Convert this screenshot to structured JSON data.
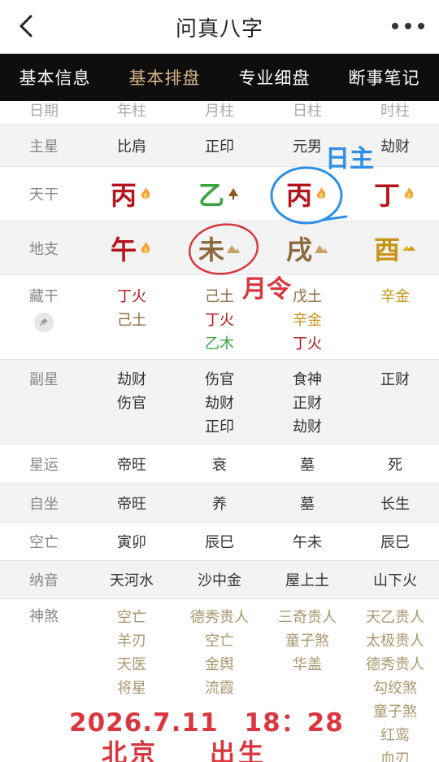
{
  "header": {
    "title": "问真八字"
  },
  "tabs": [
    {
      "label": "基本信息",
      "active": false
    },
    {
      "label": "基本排盘",
      "active": true
    },
    {
      "label": "专业细盘",
      "active": false
    },
    {
      "label": "断事笔记",
      "active": false
    }
  ],
  "columns": [
    "日期",
    "年柱",
    "月柱",
    "日柱",
    "时柱"
  ],
  "rows": {
    "zhuxing": {
      "label": "主星",
      "values": [
        "比肩",
        "正印",
        "元男",
        "劫财"
      ]
    },
    "tiangan": {
      "label": "天干",
      "values": [
        "丙",
        "乙",
        "丙",
        "丁"
      ],
      "elements": [
        "fire",
        "wood",
        "fire",
        "fire"
      ]
    },
    "dizhi": {
      "label": "地支",
      "values": [
        "午",
        "未",
        "戌",
        "酉"
      ],
      "elements": [
        "fire",
        "earth",
        "earth",
        "metal"
      ]
    },
    "canggan": {
      "label": "藏干",
      "values": [
        [
          "丁火",
          "己土"
        ],
        [
          "己土",
          "丁火",
          "乙木"
        ],
        [
          "戊土",
          "辛金",
          "丁火"
        ],
        [
          "辛金"
        ]
      ]
    },
    "fuxing": {
      "label": "副星",
      "values": [
        [
          "劫财",
          "伤官"
        ],
        [
          "伤官",
          "劫财",
          "正印"
        ],
        [
          "食神",
          "正财",
          "劫财"
        ],
        [
          "正财"
        ]
      ]
    },
    "xingyun": {
      "label": "星运",
      "values": [
        "帝旺",
        "衰",
        "墓",
        "死"
      ]
    },
    "zizuo": {
      "label": "自坐",
      "values": [
        "帝旺",
        "养",
        "墓",
        "长生"
      ]
    },
    "kongwang": {
      "label": "空亡",
      "values": [
        "寅卯",
        "辰巳",
        "午未",
        "辰巳"
      ]
    },
    "nayin": {
      "label": "纳音",
      "values": [
        "天河水",
        "沙中金",
        "屋上土",
        "山下火"
      ]
    },
    "shensha": {
      "label": "神煞",
      "values": [
        [
          "空亡",
          "羊刃",
          "天医",
          "将星"
        ],
        [
          "德秀贵人",
          "空亡",
          "金舆",
          "流霞"
        ],
        [
          "三奇贵人",
          "童子煞",
          "华盖"
        ],
        [
          "天乙贵人",
          "太极贵人",
          "德秀贵人",
          "勾绞煞",
          "童子煞",
          "红鸾",
          "血刃"
        ]
      ]
    }
  },
  "annotations": {
    "rizhu": "日主",
    "yueling": "月令",
    "date_time": "2026.7.11　18：28",
    "place": "北京",
    "birth": "出生"
  },
  "colors": {
    "fire": "#b4141b",
    "wood": "#39a33e",
    "earth": "#8b6a3e",
    "metal": "#c79419",
    "annotation_red": "#d9363e",
    "annotation_blue": "#2f8fe6"
  }
}
